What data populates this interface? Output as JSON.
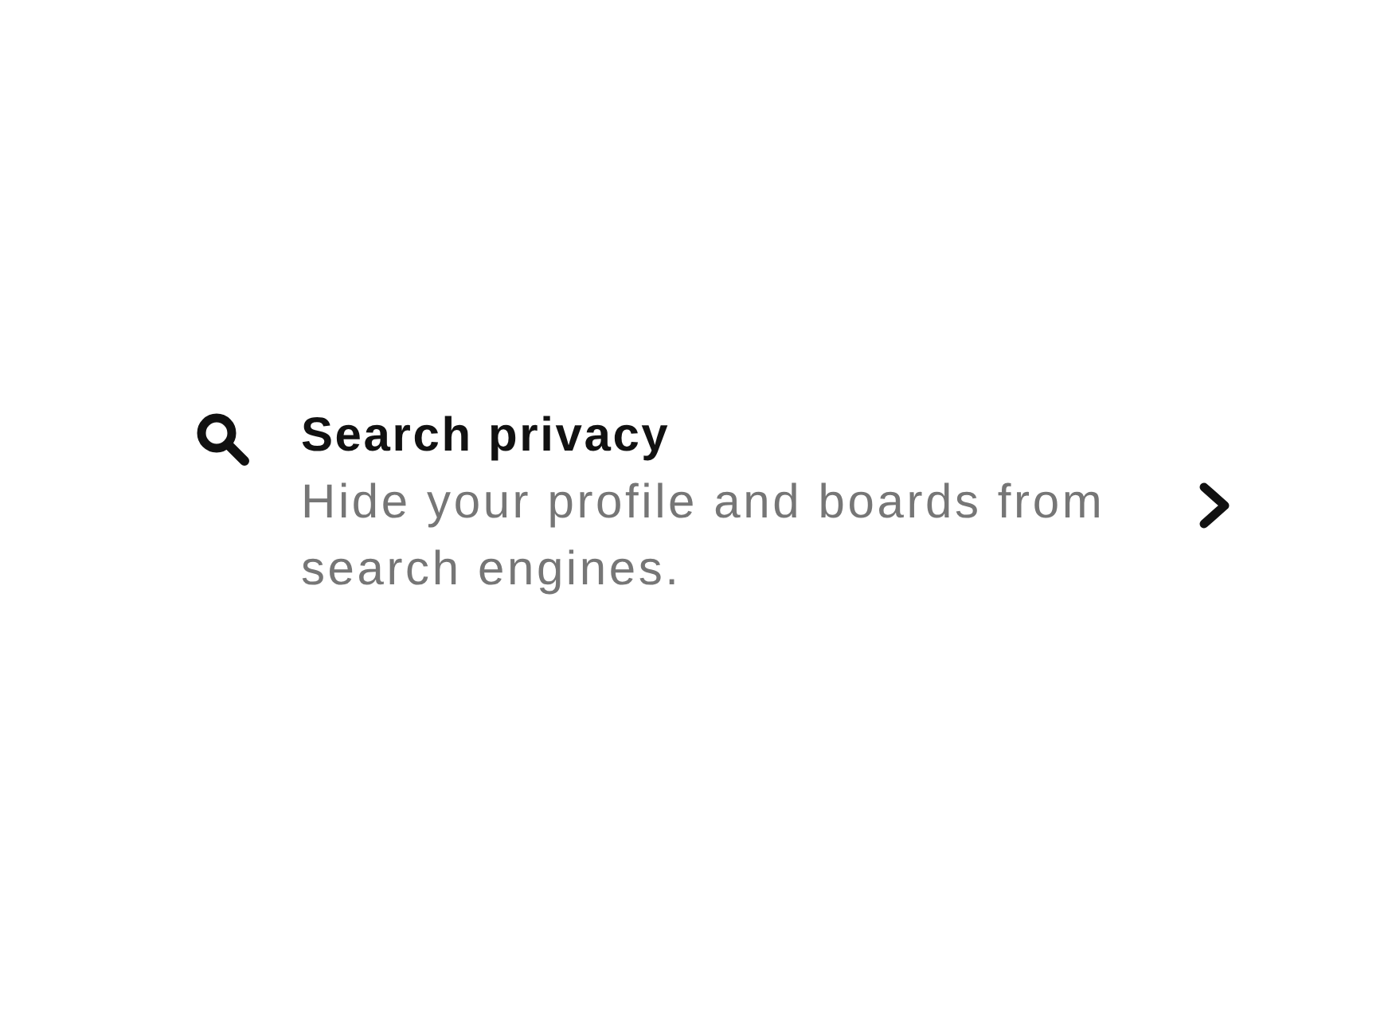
{
  "setting": {
    "title": "Search privacy",
    "description": "Hide your profile and boards from search engines."
  }
}
